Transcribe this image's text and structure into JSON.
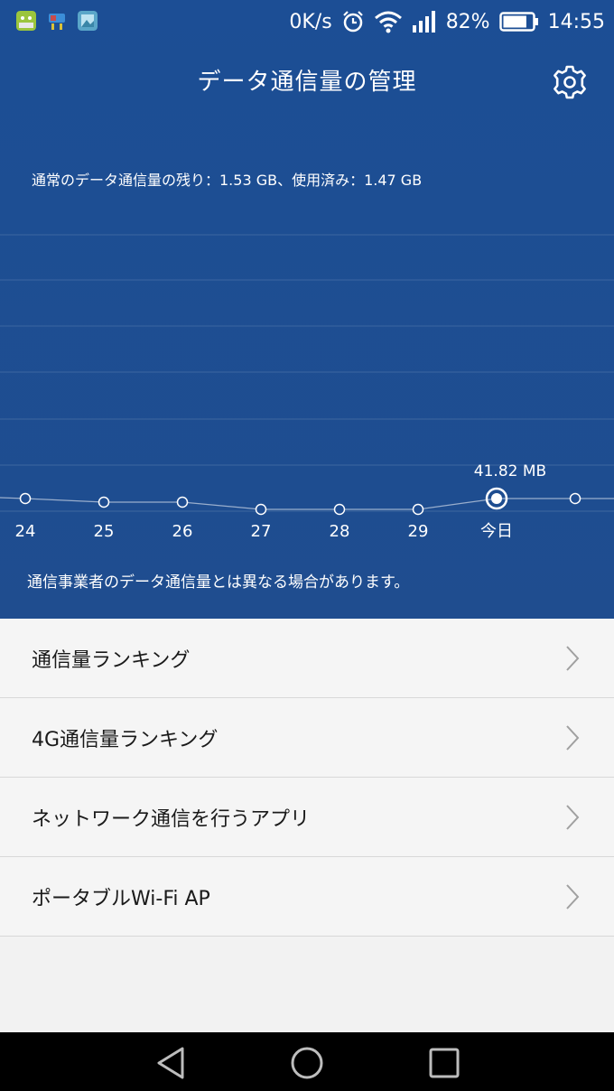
{
  "status_bar": {
    "net_speed": "0K/s",
    "battery_percent": "82%",
    "battery_level": 0.82,
    "time": "14:55",
    "app_icons": [
      "mix-app-icon",
      "stopwatch-app-icon",
      "gallery-app-icon"
    ]
  },
  "header": {
    "title": "データ通信量の管理",
    "settings_icon": "gear-icon"
  },
  "summary_text": "通常のデータ通信量の残り：1.53 GB、使用済み：1.47 GB",
  "chart_data": {
    "type": "line",
    "x": [
      "24",
      "25",
      "26",
      "27",
      "28",
      "29",
      "今日",
      ""
    ],
    "values": [
      0,
      0,
      0,
      0,
      0,
      0,
      41.82,
      0
    ],
    "highlight_label": "41.82 MB",
    "highlight_index": 6,
    "grid": true
  },
  "disclaimer": "通信事業者のデータ通信量とは異なる場合があります。",
  "menu": [
    {
      "label": "通信量ランキング"
    },
    {
      "label": "4G通信量ランキング"
    },
    {
      "label": "ネットワーク通信を行うアプリ"
    },
    {
      "label": "ポータブルWi-Fi AP"
    }
  ],
  "colors": {
    "header_bg": "#1f4d91",
    "list_bg": "#f5f5f5",
    "nav_bg": "#000000"
  }
}
